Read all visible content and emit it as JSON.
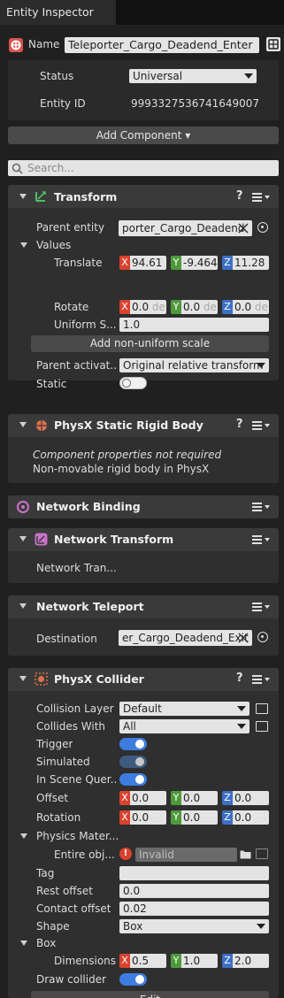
{
  "window": {
    "title": "Entity Inspector"
  },
  "entity": {
    "name_label": "Name",
    "name_value": "Teleporter_Cargo_Deadend_Enter",
    "status_label": "Status",
    "status_value": "Universal",
    "id_label": "Entity ID",
    "id_value": "9993327536741649007"
  },
  "add_component_label": "Add Component ▾",
  "search": {
    "placeholder": "Search..."
  },
  "transform": {
    "title": "Transform",
    "help": "?",
    "parent_entity_label": "Parent entity",
    "parent_entity_value": "porter_Cargo_Deadend",
    "values_label": "Values",
    "translate_label": "Translate",
    "translate": {
      "x": "94.61",
      "y": "-9.464",
      "z": "11.28"
    },
    "rotate_label": "Rotate",
    "rotate": {
      "x": "0.0",
      "y": "0.0",
      "z": "0.0",
      "unit": "de"
    },
    "uniform_label": "Uniform S...",
    "uniform_value": "1.0",
    "nonuniform_button": "Add non-uniform scale",
    "parent_activation_label": "Parent activat...",
    "parent_activation_value": "Original relative transform",
    "static_label": "Static"
  },
  "physx_static": {
    "title": "PhysX Static Rigid Body",
    "help": "?",
    "note": "Component properties not required",
    "desc": "Non-movable rigid body in PhysX"
  },
  "network_binding": {
    "title": "Network Binding"
  },
  "network_transform": {
    "title": "Network Transform",
    "body": "Network Tran..."
  },
  "network_teleport": {
    "title": "Network Teleport",
    "destination_label": "Destination",
    "destination_value": "er_Cargo_Deadend_Exit"
  },
  "collider": {
    "title": "PhysX Collider",
    "help": "?",
    "collision_layer_label": "Collision Layer",
    "collision_layer_value": "Default",
    "collides_with_label": "Collides With",
    "collides_with_value": "All",
    "trigger_label": "Trigger",
    "simulated_label": "Simulated",
    "in_scene_label": "In Scene Quer...",
    "offset_label": "Offset",
    "offset": {
      "x": "0.0",
      "y": "0.0",
      "z": "0.0"
    },
    "rotation_label": "Rotation",
    "rotation": {
      "x": "0.0",
      "y": "0.0",
      "z": "0.0"
    },
    "physics_material_label": "Physics Mater...",
    "entire_obj_label": "Entire obj...",
    "entire_obj_value": "Invalid",
    "tag_label": "Tag",
    "rest_offset_label": "Rest offset",
    "rest_offset_value": "0.0",
    "contact_offset_label": "Contact offset",
    "contact_offset_value": "0.02",
    "shape_label": "Shape",
    "shape_value": "Box",
    "box_label": "Box",
    "dimensions_label": "Dimensions",
    "dimensions": {
      "x": "0.5",
      "y": "1.0",
      "z": "2.0"
    },
    "draw_collider_label": "Draw collider",
    "edit_button": "Edit"
  },
  "colors": {
    "x_axis": "#d9422e",
    "y_axis": "#4e9a3a",
    "z_axis": "#3d6fc6",
    "toggle_on": "#3d7de0"
  }
}
